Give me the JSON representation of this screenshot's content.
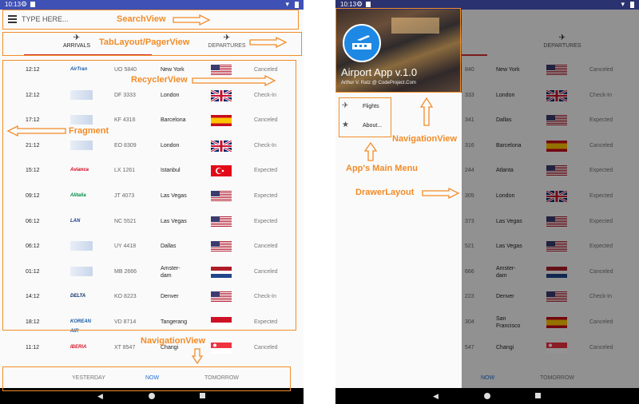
{
  "status": {
    "time": "10:13"
  },
  "search": {
    "placeholder": "TYPE HERE..."
  },
  "tabs": [
    {
      "label": "ARRIVALS"
    },
    {
      "label": "DEPARTURES"
    }
  ],
  "flights": [
    {
      "time": "12:12",
      "airline": "AirTran",
      "code": "UO 5840",
      "dest": "New York",
      "flag": "us",
      "status": "Canceled"
    },
    {
      "time": "12:12",
      "airline": "",
      "code": "DF 3333",
      "dest": "London",
      "flag": "uk",
      "status": "Check-In"
    },
    {
      "time": "17:12",
      "airline": "",
      "code": "KF 4316",
      "dest": "Barcelona",
      "flag": "es",
      "status": "Canceled"
    },
    {
      "time": "21:12",
      "airline": "",
      "code": "EO 8309",
      "dest": "London",
      "flag": "uk",
      "status": "Check-In"
    },
    {
      "time": "15:12",
      "airline": "Avianca",
      "code": "LX 1261",
      "dest": "Istanbul",
      "flag": "tr",
      "status": "Expected"
    },
    {
      "time": "09:12",
      "airline": "Alitalia",
      "code": "JT 4073",
      "dest": "Las Vegas",
      "flag": "us",
      "status": "Expected"
    },
    {
      "time": "06:12",
      "airline": "LAN",
      "code": "NC 5521",
      "dest": "Las Vegas",
      "flag": "us",
      "status": "Expected"
    },
    {
      "time": "06:12",
      "airline": "",
      "code": "UY 4418",
      "dest": "Dallas",
      "flag": "us",
      "status": "Canceled"
    },
    {
      "time": "01:12",
      "airline": "",
      "code": "MB 2666",
      "dest": "Amster-\ndam",
      "flag": "nl",
      "status": "Canceled"
    },
    {
      "time": "14:12",
      "airline": "DELTA",
      "code": "KO 8223",
      "dest": "Denver",
      "flag": "us",
      "status": "Check-In"
    },
    {
      "time": "18:12",
      "airline": "KOREAN AIR",
      "code": "VD 8714",
      "dest": "Tangerang",
      "flag": "id",
      "status": "Expected"
    },
    {
      "time": "11:12",
      "airline": "IBERIA",
      "code": "XT 8547",
      "dest": "Changi",
      "flag": "sg",
      "status": "Canceled"
    }
  ],
  "flights_right": [
    {
      "code": "840",
      "dest": "New York",
      "flag": "us",
      "status": "Canceled"
    },
    {
      "code": "333",
      "dest": "London",
      "flag": "uk",
      "status": "Check-In"
    },
    {
      "code": "341",
      "dest": "Dallas",
      "flag": "us",
      "status": "Expected"
    },
    {
      "code": "316",
      "dest": "Barcelona",
      "flag": "es",
      "status": "Canceled"
    },
    {
      "code": "244",
      "dest": "Atlanta",
      "flag": "us",
      "status": "Expected"
    },
    {
      "code": "305",
      "dest": "London",
      "flag": "uk",
      "status": "Expected"
    },
    {
      "code": "373",
      "dest": "Las Vegas",
      "flag": "us",
      "status": "Expected"
    },
    {
      "code": "521",
      "dest": "Las Vegas",
      "flag": "us",
      "status": "Expected"
    },
    {
      "code": "666",
      "dest": "Amster-\ndam",
      "flag": "nl",
      "status": "Canceled"
    },
    {
      "code": "223",
      "dest": "Denver",
      "flag": "us",
      "status": "Check-In"
    },
    {
      "code": "304",
      "dest": "San\nFrancisco",
      "flag": "es",
      "status": "Canceled"
    },
    {
      "code": "547",
      "dest": "Changi",
      "flag": "sg",
      "status": "Canceled"
    }
  ],
  "bottomnav": {
    "yesterday": "YESTERDAY",
    "now": "NOW",
    "tomorrow": "TOMORROW"
  },
  "drawer": {
    "title": "Airport App v.1.0",
    "subtitle": "Arthur V. Ratz @ CodeProject.Com",
    "menu": [
      {
        "label": "Flights",
        "icon": "plane-icon"
      },
      {
        "label": "About...",
        "icon": "star-icon"
      }
    ]
  },
  "annotations": {
    "searchview": "SearchView",
    "tablayout": "TabLayout/PagerView",
    "recyclerview": "RecyclerView",
    "fragment": "Fragment",
    "navigationview_bottom": "NavigationView",
    "navigationview_drawer": "NavigationView",
    "main_menu": "App's Main Menu",
    "drawerlayout": "DrawerLayout"
  },
  "colors": {
    "accent": "#f28c28",
    "primary": "#3f51b5",
    "now": "#1e6fd9"
  }
}
